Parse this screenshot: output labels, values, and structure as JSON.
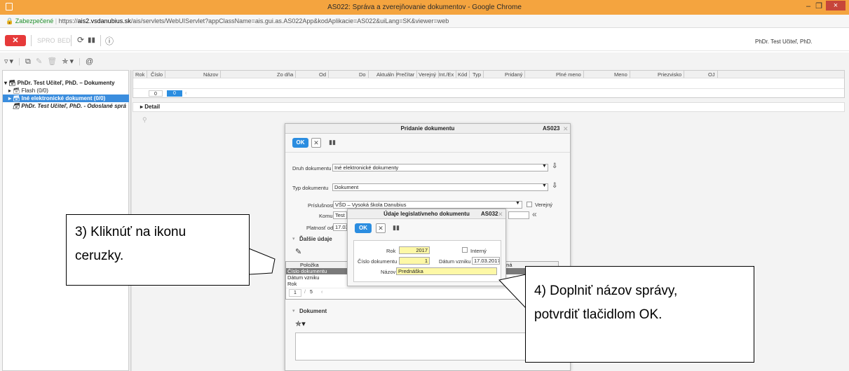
{
  "window": {
    "title": "AS022: Správa a zverejňovanie dokumentov - Google Chrome",
    "minimize": "–",
    "restore": "❐",
    "close": "×"
  },
  "address": {
    "secure_label": "Zabezpečené",
    "url_prefix": "https://",
    "host": "ais2.vsdanubius.sk",
    "path": "/ais/servlets/WebUIServlet?appClassName=ais.gui.as.AS022App&kodAplikacie=AS022&uiLang=SK&viewer=web"
  },
  "toolbar": {
    "close_label": "✕",
    "btn1": "SPRO",
    "btn2": "BED",
    "user": "PhDr. Test Učiteľ, PhD."
  },
  "tree": {
    "items": [
      {
        "label": "PhDr. Test Učiteľ, PhD. – Dokumenty",
        "arrow": "▾"
      },
      {
        "label": "Flash (0/0)",
        "arrow": "▸"
      },
      {
        "label": "Iné elektronické dokument (0/0)",
        "arrow": "▸"
      },
      {
        "label": "PhDr. Test Učiteľ, PhD. - Odoslané sprá",
        "arrow": ""
      }
    ]
  },
  "grid": {
    "columns": [
      "Rok",
      "Číslo",
      "Názov",
      "Zo dňa",
      "Od",
      "Do",
      "Aktuáln",
      "Prečítar",
      "Verejný",
      "Int./Ex",
      "Kód",
      "Typ",
      "Pridaný",
      "Plné meno",
      "Meno",
      "Priezvisko",
      "OJ"
    ],
    "pager_current": "0",
    "pager_total": "0"
  },
  "detail": {
    "label": "Detail"
  },
  "dialog_main": {
    "title": "Pridanie dokumentu",
    "code": "AS023",
    "ok": "OK",
    "druh_label": "Druh dokumentu",
    "druh_value": "Iné elektronické dokumenty",
    "typ_label": "Typ dokumentu",
    "typ_value": "Dokument",
    "prislusnost_label": "Príslušnosť",
    "prislusnost_value": "VŠD – Vysoká škola Danubius",
    "verejny_label": "Verejný",
    "komu_label": "Komu",
    "komu_value": "Test",
    "platnost_label": "Platnosť od",
    "platnost_value": "17.03",
    "dalsie_label": "Ďalšie údaje",
    "polozka_header": "Položka",
    "col2_header": "nná",
    "rows": [
      "Číslo dokumentu",
      "Dátum vzniku",
      "Rok"
    ],
    "pager_current": "1",
    "pager_total": "5",
    "dokument_label": "Dokument"
  },
  "dialog_leg": {
    "title": "Údaje legislatívneho dokumentu",
    "code": "AS032",
    "ok": "OK",
    "rok_label": "Rok",
    "rok_value": "2017",
    "interny_label": "Interný",
    "cislo_label": "Číslo dokumentu",
    "cislo_value": "1",
    "datum_label": "Dátum vzniku",
    "datum_value": "17.03.2017",
    "nazov_label": "Názov",
    "nazov_value": "Prednáška"
  },
  "callouts": {
    "left_line1": "3) Kliknúť na ikonu",
    "left_line2": "ceruzky.",
    "right_line1": "4) Doplniť názov správy,",
    "right_line2": "potvrdiť tlačidlom OK."
  }
}
